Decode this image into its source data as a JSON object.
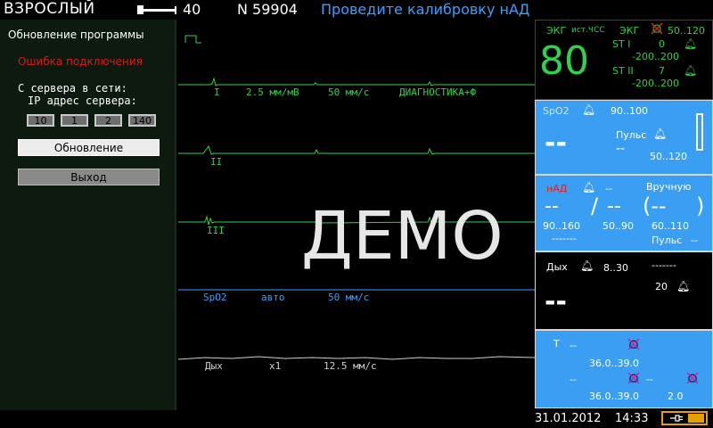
{
  "topbar": {
    "mode": "ВЗРОСЛЫЙ",
    "age": "40",
    "patient_no": "N 59904",
    "alarm_message": "Проведите калибровку нАД"
  },
  "left_panel": {
    "title": "Обновление программы",
    "error": "Ошибка подключения",
    "server_label": "С сервера в сети:",
    "ip_label": "IP адрес сервера:",
    "ip_octets": [
      "10",
      "1",
      "2",
      "140"
    ],
    "update_button": "Обновление",
    "exit_button": "Выход"
  },
  "waves": {
    "ecg1": {
      "lead": "I",
      "gain": "2.5 мм/мВ",
      "speed": "50 мм/с",
      "filter": "ДИАГНОСТИКА+Ф"
    },
    "ecg2": {
      "lead": "II"
    },
    "ecg3": {
      "lead": "III"
    },
    "spo2": {
      "name": "SpO2",
      "mode": "авто",
      "speed": "50 мм/с"
    },
    "resp": {
      "name": "Дых",
      "gain": "x1",
      "speed": "12.5 мм/с"
    },
    "demo_text": "ДЕМО"
  },
  "ecg_panel": {
    "label": "ЭКГ",
    "source": "ист.ЧСС",
    "label2": "ЭКГ",
    "hr_limits": "50..120",
    "hr_value": "80",
    "st1_label": "ST I",
    "st1_value": "0",
    "st1_limits": "-200..200",
    "st2_label": "ST II",
    "st2_value": "7",
    "st2_limits": "-200..200"
  },
  "spo2_panel": {
    "label": "SpO2",
    "limits": "90..100",
    "value": "--",
    "pulse_label": "Пульс",
    "pulse_value": "--",
    "pulse_limits": "50..120"
  },
  "nibp_panel": {
    "label": "нАД",
    "status": "--",
    "mode": "Вручную",
    "sys": "--",
    "slash": "/",
    "dia": "--",
    "mean": "(--",
    "mean_close": ")",
    "sys_limits": "90..160",
    "dia_limits": "50..90",
    "mean_limits": "60..110",
    "time_placeholder": "-------",
    "pulse_label": "Пульс",
    "pulse_value": "--"
  },
  "resp_panel": {
    "label": "Дых",
    "limits": "8..30",
    "apnea_placeholder": "-------",
    "apnea_value": "20",
    "value": "--"
  },
  "temp_panel": {
    "label": "T",
    "t1_value": "--",
    "t1_limits": "36.0..39.0",
    "t2_value": "--",
    "t2_limits": "36.0..39.0",
    "t3_value": "--",
    "dt_limit": "2.0"
  },
  "footer": {
    "date": "31.01.2012",
    "time": "14:33"
  },
  "colors": {
    "ecg_wave": "#2fd24a",
    "spo2_wave": "#3aa0ff",
    "resp_wave": "#d0d0d0",
    "panel_blue": "#3a9ff2",
    "alarm_text": "#3aa0ff",
    "error_text": "#e01818"
  }
}
